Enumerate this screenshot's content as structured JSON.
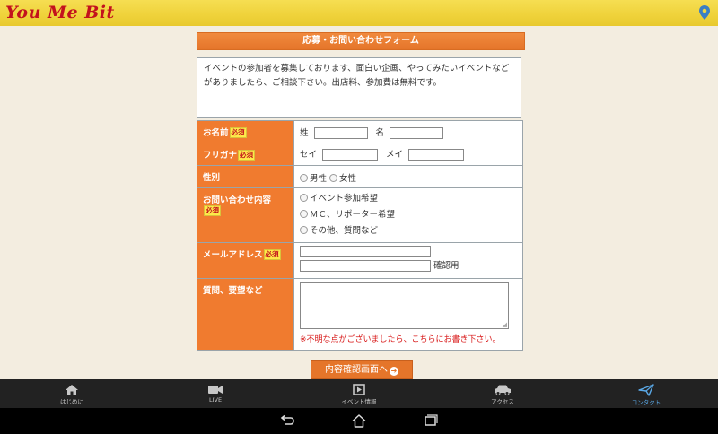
{
  "header": {
    "logo": "You Me Bit",
    "location_icon": "map-pin-icon"
  },
  "form": {
    "title": "応募・お問い合わせフォーム",
    "intro": "イベントの参加者を募集しております、面白い企画、やってみたいイベントなどがありましたら、ご相談下さい。出店料、参加費は無料です。",
    "required_badge": "必須",
    "name": {
      "label": "お名前",
      "sei": "姓",
      "mei": "名"
    },
    "furigana": {
      "label": "フリガナ",
      "sei": "セイ",
      "mei": "メイ"
    },
    "gender": {
      "label": "性別",
      "options": [
        "男性",
        "女性"
      ]
    },
    "inquiry": {
      "label": "お問い合わせ内容",
      "options": [
        "イベント参加希望",
        "ＭＣ、リポーター希望",
        "その他、質問など"
      ]
    },
    "email": {
      "label": "メールアドレス",
      "confirm": "確認用"
    },
    "questions": {
      "label": "質問、要望など",
      "note": "※不明な点がございましたら、こちらにお書き下さい。"
    },
    "confirm_button": "内容確認画面へ"
  },
  "bottom_nav": [
    {
      "label": "はじめに",
      "icon": "home-icon"
    },
    {
      "label": "LIVE",
      "icon": "video-camera-icon"
    },
    {
      "label": "イベント情報",
      "icon": "play-box-icon"
    },
    {
      "label": "アクセス",
      "icon": "car-icon"
    },
    {
      "label": "コンタクト",
      "icon": "paper-plane-icon"
    }
  ],
  "colors": {
    "accent": "#f07b2f",
    "active_nav": "#5aa8e6",
    "required": "#ffe94a"
  }
}
